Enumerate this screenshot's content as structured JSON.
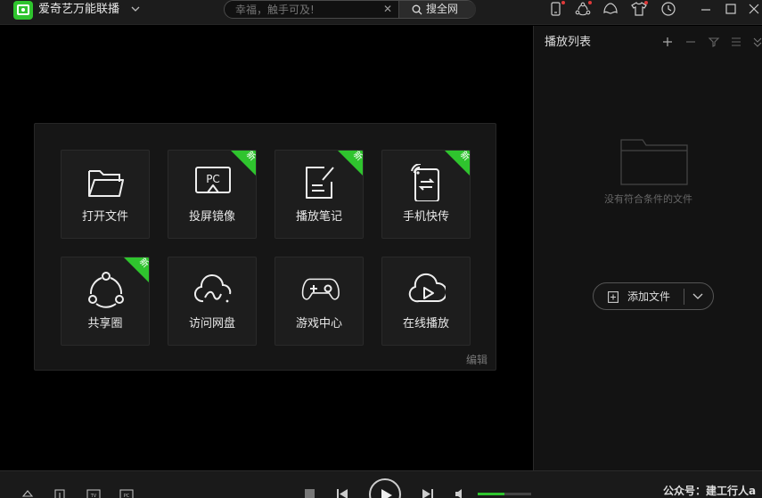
{
  "app": {
    "title": "爱奇艺万能联播"
  },
  "search": {
    "value": "",
    "placeholder": "幸福，触手可及!",
    "button_label": "搜全网"
  },
  "titlebar_icons": [
    "phone-icon",
    "share-icon",
    "skin-icon",
    "shirt-icon",
    "history-icon",
    "minimize-icon",
    "maximize-icon",
    "close-icon"
  ],
  "tools": [
    {
      "label": "打开文件",
      "icon": "folder-icon",
      "is_new": false
    },
    {
      "label": "投屏镜像",
      "icon": "pc-cast-icon",
      "is_new": true
    },
    {
      "label": "播放笔记",
      "icon": "note-icon",
      "is_new": true
    },
    {
      "label": "手机快传",
      "icon": "phone-transfer-icon",
      "is_new": true
    },
    {
      "label": "共享圈",
      "icon": "share-circle-icon",
      "is_new": true
    },
    {
      "label": "访问网盘",
      "icon": "cloud-disk-icon",
      "is_new": false
    },
    {
      "label": "游戏中心",
      "icon": "gamepad-icon",
      "is_new": false
    },
    {
      "label": "在线播放",
      "icon": "cloud-play-icon",
      "is_new": false
    }
  ],
  "badge_text": "新",
  "panel": {
    "edit_label": "编辑"
  },
  "playlist": {
    "title": "播放列表",
    "empty_text": "没有符合条件的文件",
    "add_file_label": "添加文件"
  },
  "player": {
    "volume": 0.5
  },
  "watermark": "公众号：建工行人a",
  "colors": {
    "accent": "#2fc42e",
    "background": "#000000",
    "panel": "#161616"
  }
}
